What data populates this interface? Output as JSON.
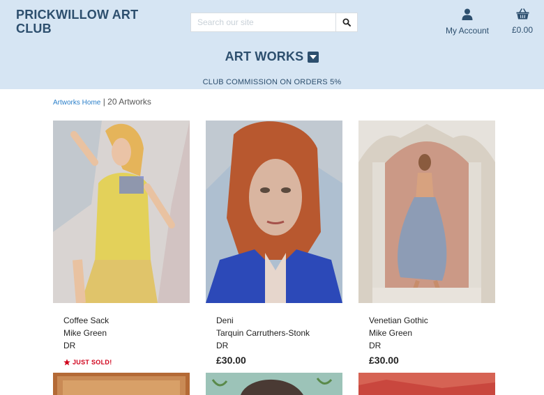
{
  "header": {
    "brand_line1": "PRICKWILLOW ART",
    "brand_line2": "CLUB",
    "search_placeholder": "Search our site",
    "account_label": "My Account",
    "basket_total": "£0.00"
  },
  "nav": {
    "title": "ART WORKS",
    "commission": "CLUB COMMISSION ON ORDERS 5%"
  },
  "breadcrumb": {
    "home": "Artworks Home",
    "separator": "|",
    "count": "20 Artworks"
  },
  "artworks": [
    {
      "title": "Coffee Sack",
      "artist": "Mike Green",
      "code": "DR",
      "badge": "JUST SOLD!"
    },
    {
      "title": "Deni",
      "artist": "Tarquin Carruthers-Stonk",
      "code": "DR",
      "price": "£30.00"
    },
    {
      "title": "Venetian Gothic",
      "artist": "Mike Green",
      "code": "DR",
      "price": "£30.00"
    }
  ],
  "colors": {
    "header_bg": "#d6e5f3",
    "brand": "#2d4f6e",
    "link": "#2a7fc9",
    "sold": "#d0021b"
  },
  "icons": [
    "search-icon",
    "user-icon",
    "basket-icon",
    "caret-down-icon",
    "star-icon"
  ]
}
